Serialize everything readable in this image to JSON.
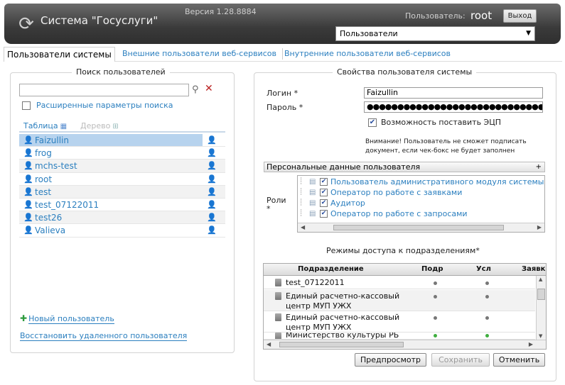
{
  "header": {
    "app_title": "Система \"Госуслуги\"",
    "version": "Версия 1.28.8884",
    "user_label": "Пользователь:",
    "user_name": "root",
    "logout_label": "Выход",
    "module_select_value": "Пользователи"
  },
  "tabs": [
    {
      "label": "Пользователи системы",
      "active": true
    },
    {
      "label": "Внешние пользователи веб-сервисов",
      "active": false
    },
    {
      "label": "Внутренние пользователи веб-сервисов",
      "active": false
    }
  ],
  "search": {
    "legend": "Поиск пользователей",
    "query": "",
    "advanced_label": "Расширенные параметры поиска",
    "advanced_checked": false,
    "view_table_label": "Таблица",
    "view_tree_label": "Дерево"
  },
  "users": [
    {
      "name": "Faizullin",
      "selected": true
    },
    {
      "name": "frog",
      "selected": false
    },
    {
      "name": "mchs-test",
      "selected": false
    },
    {
      "name": "root",
      "selected": false
    },
    {
      "name": "test",
      "selected": false
    },
    {
      "name": "test_07122011",
      "selected": false
    },
    {
      "name": "test26",
      "selected": false
    },
    {
      "name": "Valieva",
      "selected": false
    }
  ],
  "left_actions": {
    "new_user": "Новый пользователь",
    "restore_user": "Восстановить удаленного пользователя"
  },
  "properties": {
    "legend": "Свойства пользователя системы",
    "login_label": "Логин *",
    "login_value": "Faizullin",
    "password_label": "Пароль *",
    "password_value": "●●●●●●●●●●●●●●●●●●●●●●●●●●●●●●●●●●●●●●●●●●●●",
    "ecp_label": "Возможность поставить ЭЦП",
    "ecp_checked": true,
    "notice": "Внимание! Пользователь не сможет подписать документ, если чек-бокс не будет заполнен",
    "personal_section": "Персональные данные пользователя",
    "personal_expand": "+",
    "roles_label": "Роли",
    "roles_required": "*",
    "roles": [
      {
        "label": "Пользователь административного модуля системы",
        "checked": true
      },
      {
        "label": "Оператор по работе с заявками",
        "checked": true
      },
      {
        "label": "Аудитор",
        "checked": true
      },
      {
        "label": "Оператор по работе с запросами",
        "checked": true
      }
    ],
    "access_title": "Режимы доступа к подразделениям*",
    "grid_headers": {
      "division": "Подразделение",
      "podr": "Подр",
      "usl": "Усл",
      "zayavki": "Заявки"
    },
    "divisions": [
      {
        "name": "test_07122011",
        "podr": "gray",
        "usl": "gray"
      },
      {
        "name": "Единый расчетно-кассовый центр МУП УЖХ",
        "podr": "gray",
        "usl": "gray"
      },
      {
        "name": "Единый расчетно-кассовый центр МУП УЖХ",
        "podr": "gray",
        "usl": "gray"
      },
      {
        "name": "Министерство культуры РБ",
        "podr": "green",
        "usl": "green"
      }
    ]
  },
  "buttons": {
    "preview": "Предпросмотр",
    "save": "Сохранить",
    "cancel": "Отменить"
  },
  "colors": {
    "link": "#2b7fbf",
    "selected_row": "#b7d3ee",
    "header_bg": "#3a3a3a"
  }
}
